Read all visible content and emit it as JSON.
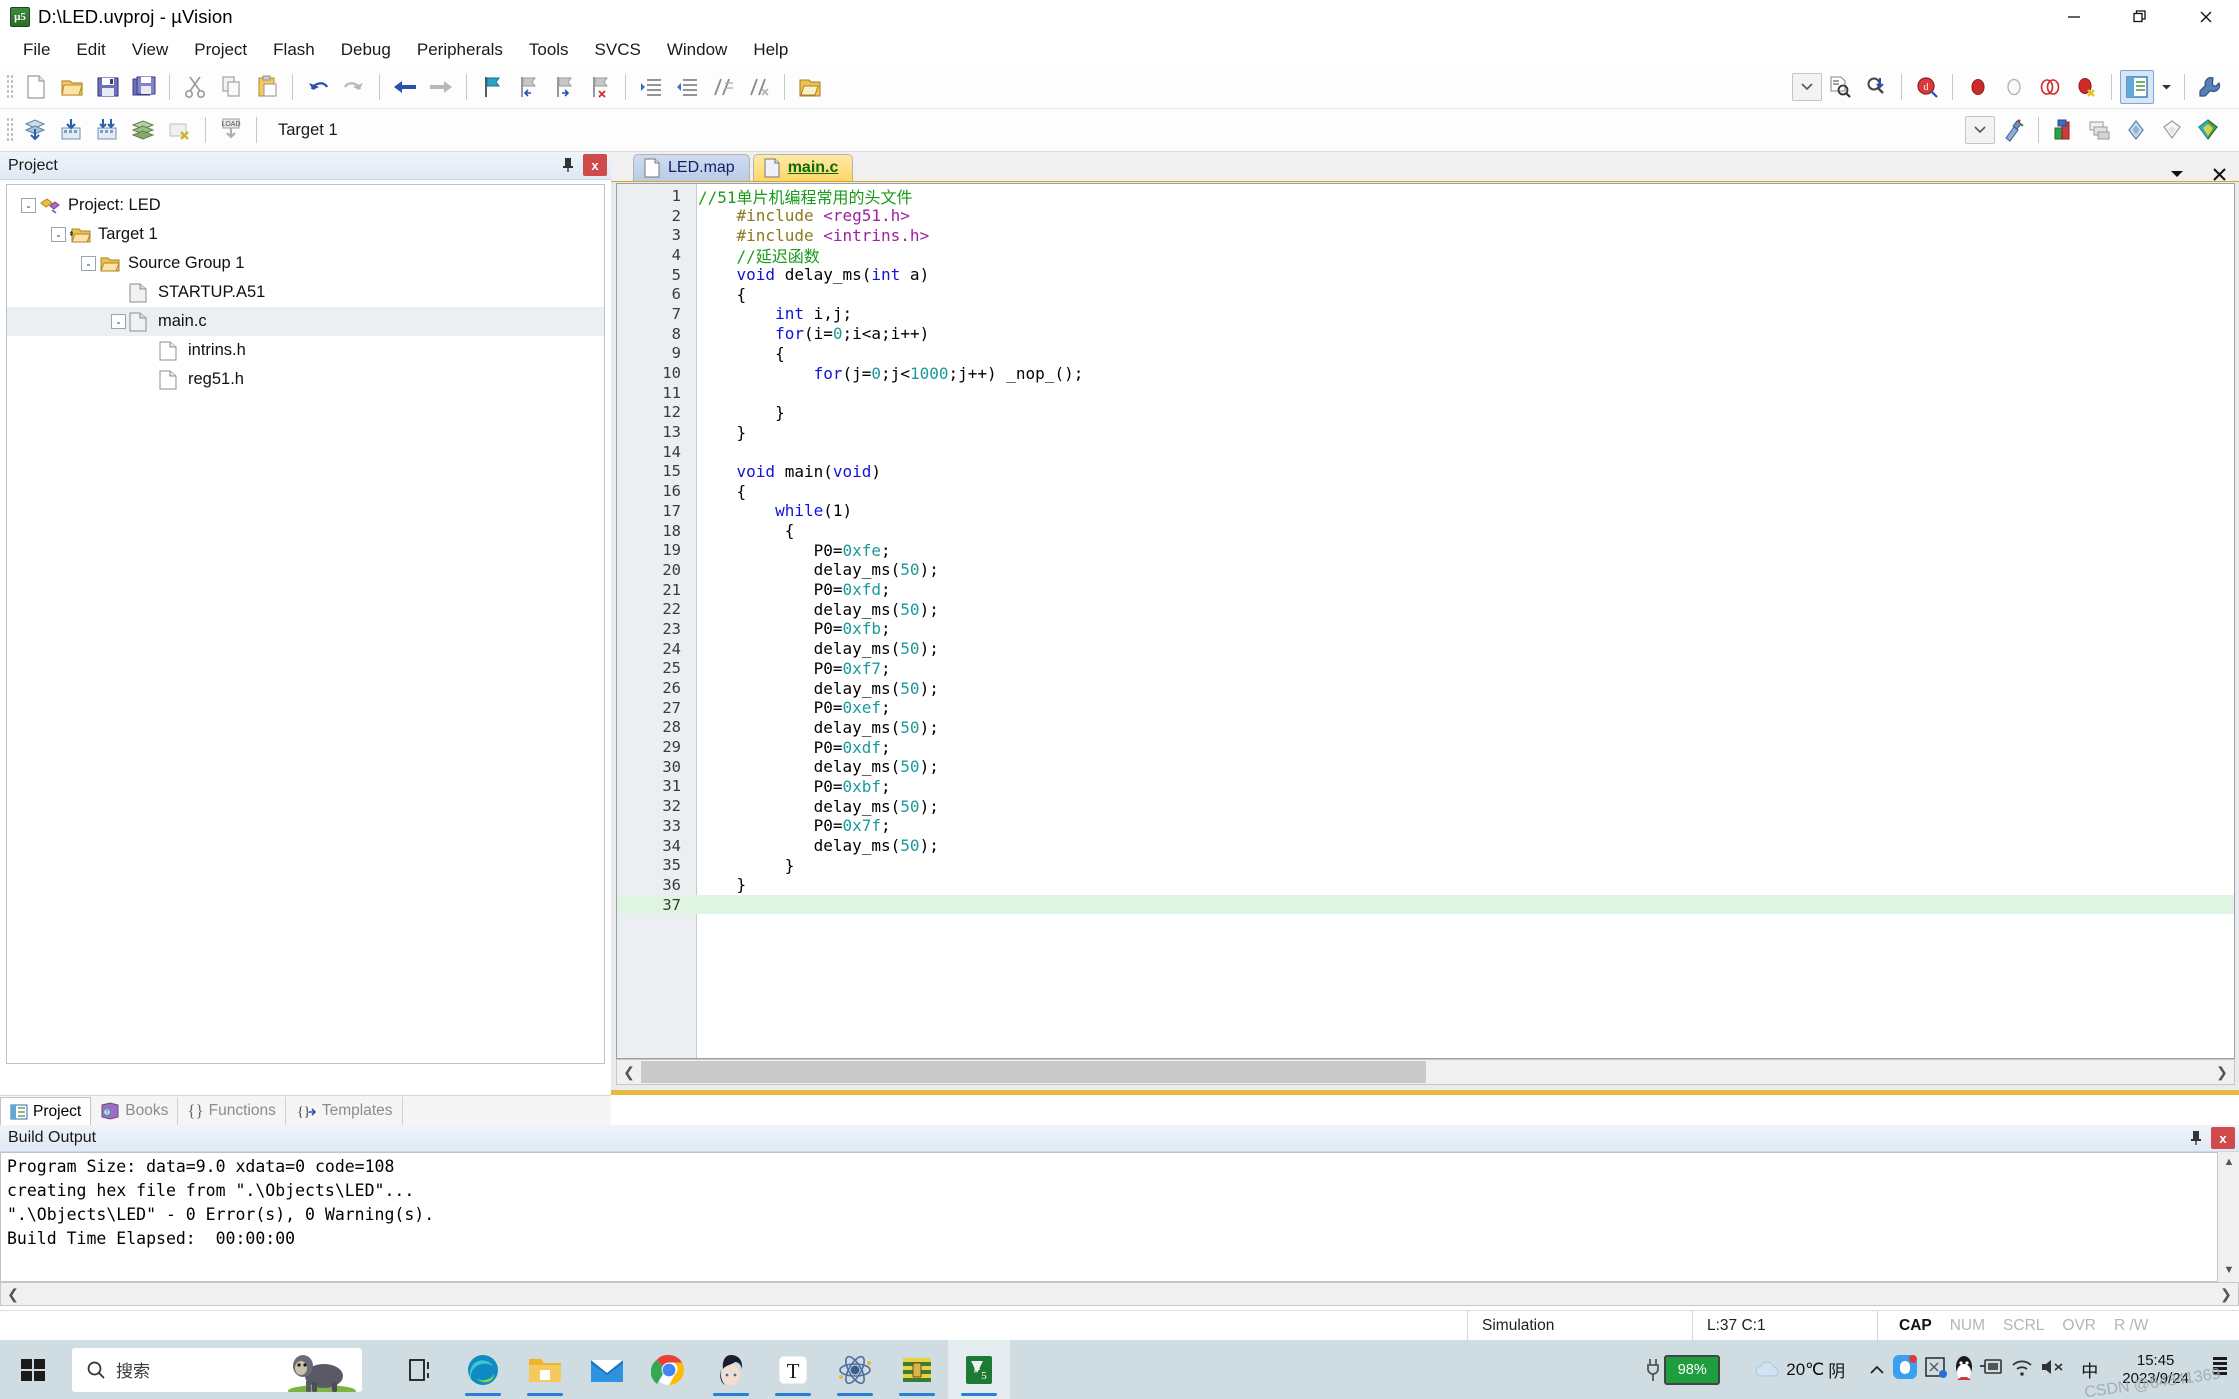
{
  "window": {
    "title": "D:\\LED.uvproj - µVision",
    "app_icon": "uvision-icon",
    "minimize": "minimize-icon",
    "restore": "restore-icon",
    "close": "close-icon"
  },
  "menu": {
    "items": [
      "File",
      "Edit",
      "View",
      "Project",
      "Flash",
      "Debug",
      "Peripherals",
      "Tools",
      "SVCS",
      "Window",
      "Help"
    ]
  },
  "toolbar1": {
    "icons": [
      "new-file-icon",
      "open-file-icon",
      "save-icon",
      "save-all-icon",
      "cut-icon",
      "copy-icon",
      "paste-icon",
      "undo-icon",
      "redo-icon",
      "back-icon",
      "forward-icon",
      "bookmark-toggle-icon",
      "bookmark-prev-icon",
      "bookmark-next-icon",
      "bookmark-clear-icon",
      "indent-icon",
      "outdent-icon",
      "comment-icon",
      "uncomment-icon",
      "open-folder-icon",
      "find-combo-icon",
      "find-in-files-icon",
      "incremental-find-icon",
      "debug-start-icon",
      "breakpoint-icon",
      "breakpoint-disable-icon",
      "breakpoints-kill-all-icon",
      "breakpoint-remove-icon",
      "window-manager-icon",
      "configuration-icon"
    ]
  },
  "toolbar2": {
    "icons": [
      "translate-icon",
      "build-icon",
      "rebuild-icon",
      "batch-build-icon",
      "stop-build-icon",
      "download-icon"
    ],
    "target_label": "Target 1",
    "dropdown": "chevron-down-icon",
    "more_icons": [
      "target-options-icon",
      "manage-project-items-icon",
      "components-icon",
      "multi-project-icon",
      "pack-installer-icon",
      "batch-setup-icon"
    ]
  },
  "project_panel": {
    "caption": "Project",
    "pin_icon": "pin-icon",
    "close_icon": "close-icon",
    "tree": [
      {
        "label": "Project: LED",
        "depth": 0,
        "expander": "-",
        "icon": "project-icon",
        "selected": false
      },
      {
        "label": "Target 1",
        "depth": 1,
        "expander": "-",
        "icon": "target-folder-icon",
        "selected": false
      },
      {
        "label": "Source Group 1",
        "depth": 2,
        "expander": "-",
        "icon": "folder-icon",
        "selected": false
      },
      {
        "label": "STARTUP.A51",
        "depth": 3,
        "expander": "",
        "icon": "asm-file-icon",
        "selected": false
      },
      {
        "label": "main.c",
        "depth": 3,
        "expander": "-",
        "icon": "c-file-icon",
        "selected": true
      },
      {
        "label": "intrins.h",
        "depth": 4,
        "expander": "",
        "icon": "header-file-icon",
        "selected": false
      },
      {
        "label": "reg51.h",
        "depth": 4,
        "expander": "",
        "icon": "header-file-icon",
        "selected": false
      }
    ],
    "tabs": [
      {
        "label": "Project",
        "icon": "project-tab-icon",
        "active": true
      },
      {
        "label": "Books",
        "icon": "books-icon",
        "active": false
      },
      {
        "label": "Functions",
        "icon": "functions-icon",
        "active": false
      },
      {
        "label": "Templates",
        "icon": "templates-icon",
        "active": false
      }
    ]
  },
  "editor": {
    "tabs": [
      {
        "label": "LED.map",
        "icon": "map-file-icon",
        "active": false
      },
      {
        "label": "main.c",
        "icon": "c-file-icon",
        "active": true
      }
    ],
    "dropdown_icon": "chevron-down-icon",
    "close_icon": "close-icon",
    "current_line": 37,
    "lines": [
      {
        "n": 1,
        "segments": [
          {
            "t": "//51单片机编程常用的头文件",
            "c": "c-com"
          }
        ]
      },
      {
        "n": 2,
        "segments": [
          {
            "t": "    ",
            "c": ""
          },
          {
            "t": "#include ",
            "c": "c-pre"
          },
          {
            "t": "<reg51.h>",
            "c": "c-str"
          }
        ]
      },
      {
        "n": 3,
        "segments": [
          {
            "t": "    ",
            "c": ""
          },
          {
            "t": "#include ",
            "c": "c-pre"
          },
          {
            "t": "<intrins.h>",
            "c": "c-str"
          }
        ]
      },
      {
        "n": 4,
        "segments": [
          {
            "t": "    ",
            "c": ""
          },
          {
            "t": "//延迟函数",
            "c": "c-com"
          }
        ]
      },
      {
        "n": 5,
        "segments": [
          {
            "t": "    ",
            "c": ""
          },
          {
            "t": "void",
            "c": "c-kw"
          },
          {
            "t": " delay_ms(",
            "c": ""
          },
          {
            "t": "int",
            "c": "c-kw"
          },
          {
            "t": " a)",
            "c": ""
          }
        ]
      },
      {
        "n": 6,
        "segments": [
          {
            "t": "    {",
            "c": ""
          }
        ]
      },
      {
        "n": 7,
        "segments": [
          {
            "t": "        ",
            "c": ""
          },
          {
            "t": "int",
            "c": "c-kw"
          },
          {
            "t": " i,j;",
            "c": ""
          }
        ]
      },
      {
        "n": 8,
        "segments": [
          {
            "t": "        ",
            "c": ""
          },
          {
            "t": "for",
            "c": "c-kw"
          },
          {
            "t": "(i=",
            "c": ""
          },
          {
            "t": "0",
            "c": "c-num"
          },
          {
            "t": ";i<a;i++)",
            "c": ""
          }
        ]
      },
      {
        "n": 9,
        "segments": [
          {
            "t": "        {",
            "c": ""
          }
        ]
      },
      {
        "n": 10,
        "segments": [
          {
            "t": "            ",
            "c": ""
          },
          {
            "t": "for",
            "c": "c-kw"
          },
          {
            "t": "(j=",
            "c": ""
          },
          {
            "t": "0",
            "c": "c-num"
          },
          {
            "t": ";j<",
            "c": ""
          },
          {
            "t": "1000",
            "c": "c-num"
          },
          {
            "t": ";j++) _nop_();",
            "c": ""
          }
        ]
      },
      {
        "n": 11,
        "segments": [
          {
            "t": "",
            "c": ""
          }
        ]
      },
      {
        "n": 12,
        "segments": [
          {
            "t": "        }",
            "c": ""
          }
        ]
      },
      {
        "n": 13,
        "segments": [
          {
            "t": "    }",
            "c": ""
          }
        ]
      },
      {
        "n": 14,
        "segments": [
          {
            "t": "",
            "c": ""
          }
        ]
      },
      {
        "n": 15,
        "segments": [
          {
            "t": "    ",
            "c": ""
          },
          {
            "t": "void",
            "c": "c-kw"
          },
          {
            "t": " main(",
            "c": ""
          },
          {
            "t": "void",
            "c": "c-kw"
          },
          {
            "t": ")",
            "c": ""
          }
        ]
      },
      {
        "n": 16,
        "segments": [
          {
            "t": "    {",
            "c": ""
          }
        ]
      },
      {
        "n": 17,
        "segments": [
          {
            "t": "        ",
            "c": ""
          },
          {
            "t": "while",
            "c": "c-kw"
          },
          {
            "t": "(1)",
            "c": ""
          }
        ]
      },
      {
        "n": 18,
        "segments": [
          {
            "t": "         {",
            "c": ""
          }
        ]
      },
      {
        "n": 19,
        "segments": [
          {
            "t": "            P0=",
            "c": ""
          },
          {
            "t": "0xfe",
            "c": "c-num"
          },
          {
            "t": ";",
            "c": ""
          }
        ]
      },
      {
        "n": 20,
        "segments": [
          {
            "t": "            delay_ms(",
            "c": ""
          },
          {
            "t": "50",
            "c": "c-num"
          },
          {
            "t": ");",
            "c": ""
          }
        ]
      },
      {
        "n": 21,
        "segments": [
          {
            "t": "            P0=",
            "c": ""
          },
          {
            "t": "0xfd",
            "c": "c-num"
          },
          {
            "t": ";",
            "c": ""
          }
        ]
      },
      {
        "n": 22,
        "segments": [
          {
            "t": "            delay_ms(",
            "c": ""
          },
          {
            "t": "50",
            "c": "c-num"
          },
          {
            "t": ");",
            "c": ""
          }
        ]
      },
      {
        "n": 23,
        "segments": [
          {
            "t": "            P0=",
            "c": ""
          },
          {
            "t": "0xfb",
            "c": "c-num"
          },
          {
            "t": ";",
            "c": ""
          }
        ]
      },
      {
        "n": 24,
        "segments": [
          {
            "t": "            delay_ms(",
            "c": ""
          },
          {
            "t": "50",
            "c": "c-num"
          },
          {
            "t": ");",
            "c": ""
          }
        ]
      },
      {
        "n": 25,
        "segments": [
          {
            "t": "            P0=",
            "c": ""
          },
          {
            "t": "0xf7",
            "c": "c-num"
          },
          {
            "t": ";",
            "c": ""
          }
        ]
      },
      {
        "n": 26,
        "segments": [
          {
            "t": "            delay_ms(",
            "c": ""
          },
          {
            "t": "50",
            "c": "c-num"
          },
          {
            "t": ");",
            "c": ""
          }
        ]
      },
      {
        "n": 27,
        "segments": [
          {
            "t": "            P0=",
            "c": ""
          },
          {
            "t": "0xef",
            "c": "c-num"
          },
          {
            "t": ";",
            "c": ""
          }
        ]
      },
      {
        "n": 28,
        "segments": [
          {
            "t": "            delay_ms(",
            "c": ""
          },
          {
            "t": "50",
            "c": "c-num"
          },
          {
            "t": ");",
            "c": ""
          }
        ]
      },
      {
        "n": 29,
        "segments": [
          {
            "t": "            P0=",
            "c": ""
          },
          {
            "t": "0xdf",
            "c": "c-num"
          },
          {
            "t": ";",
            "c": ""
          }
        ]
      },
      {
        "n": 30,
        "segments": [
          {
            "t": "            delay_ms(",
            "c": ""
          },
          {
            "t": "50",
            "c": "c-num"
          },
          {
            "t": ");",
            "c": ""
          }
        ]
      },
      {
        "n": 31,
        "segments": [
          {
            "t": "            P0=",
            "c": ""
          },
          {
            "t": "0xbf",
            "c": "c-num"
          },
          {
            "t": ";",
            "c": ""
          }
        ]
      },
      {
        "n": 32,
        "segments": [
          {
            "t": "            delay_ms(",
            "c": ""
          },
          {
            "t": "50",
            "c": "c-num"
          },
          {
            "t": ");",
            "c": ""
          }
        ]
      },
      {
        "n": 33,
        "segments": [
          {
            "t": "            P0=",
            "c": ""
          },
          {
            "t": "0x7f",
            "c": "c-num"
          },
          {
            "t": ";",
            "c": ""
          }
        ]
      },
      {
        "n": 34,
        "segments": [
          {
            "t": "            delay_ms(",
            "c": ""
          },
          {
            "t": "50",
            "c": "c-num"
          },
          {
            "t": ");",
            "c": ""
          }
        ]
      },
      {
        "n": 35,
        "segments": [
          {
            "t": "         }",
            "c": ""
          }
        ]
      },
      {
        "n": 36,
        "segments": [
          {
            "t": "    }",
            "c": ""
          }
        ]
      },
      {
        "n": 37,
        "segments": [
          {
            "t": "",
            "c": ""
          }
        ]
      }
    ]
  },
  "build_output": {
    "caption": "Build Output",
    "pin_icon": "pin-icon",
    "close_icon": "close-icon",
    "lines": [
      "Program Size: data=9.0 xdata=0 code=108",
      "creating hex file from \".\\Objects\\LED\"...",
      "\".\\Objects\\LED\" - 0 Error(s), 0 Warning(s).",
      "Build Time Elapsed:  00:00:00"
    ]
  },
  "statusbar": {
    "mode": "Simulation",
    "position": "L:37 C:1",
    "indicators": [
      {
        "label": "CAP",
        "on": true
      },
      {
        "label": "NUM",
        "on": false
      },
      {
        "label": "SCRL",
        "on": false
      },
      {
        "label": "OVR",
        "on": false
      },
      {
        "label": "R /W",
        "on": false
      }
    ]
  },
  "taskbar": {
    "start_icon": "windows-start-icon",
    "search_placeholder": "搜索",
    "search_icon": "search-icon",
    "search_image": "gorilla-image",
    "task_view_icon": "task-view-icon",
    "apps": [
      {
        "name": "edge-icon",
        "open": true
      },
      {
        "name": "explorer-icon",
        "open": true
      },
      {
        "name": "mail-icon",
        "open": false
      },
      {
        "name": "chrome-icon",
        "open": false
      },
      {
        "name": "avatar-icon",
        "open": true
      },
      {
        "name": "typora-icon",
        "open": true
      },
      {
        "name": "proteus-icon",
        "open": true
      },
      {
        "name": "winrar-icon",
        "open": true
      },
      {
        "name": "keil-uvision-icon",
        "open": true
      }
    ],
    "battery": "98%",
    "battery_icon": "battery-charging-icon",
    "weather_icon": "cloud-icon",
    "weather_temp": "20℃",
    "weather_desc": "阴",
    "tray_expand_icon": "chevron-up-icon",
    "tray_icons": [
      "qq-music-icon",
      "screenshot-icon",
      "qq-icon",
      "usb-icon",
      "wifi-icon",
      "volume-mute-icon"
    ],
    "ime": "中",
    "time": "15:45",
    "date": "2023/9/24",
    "notification_icon": "notification-icon",
    "watermark": "CSDN @64341369"
  }
}
